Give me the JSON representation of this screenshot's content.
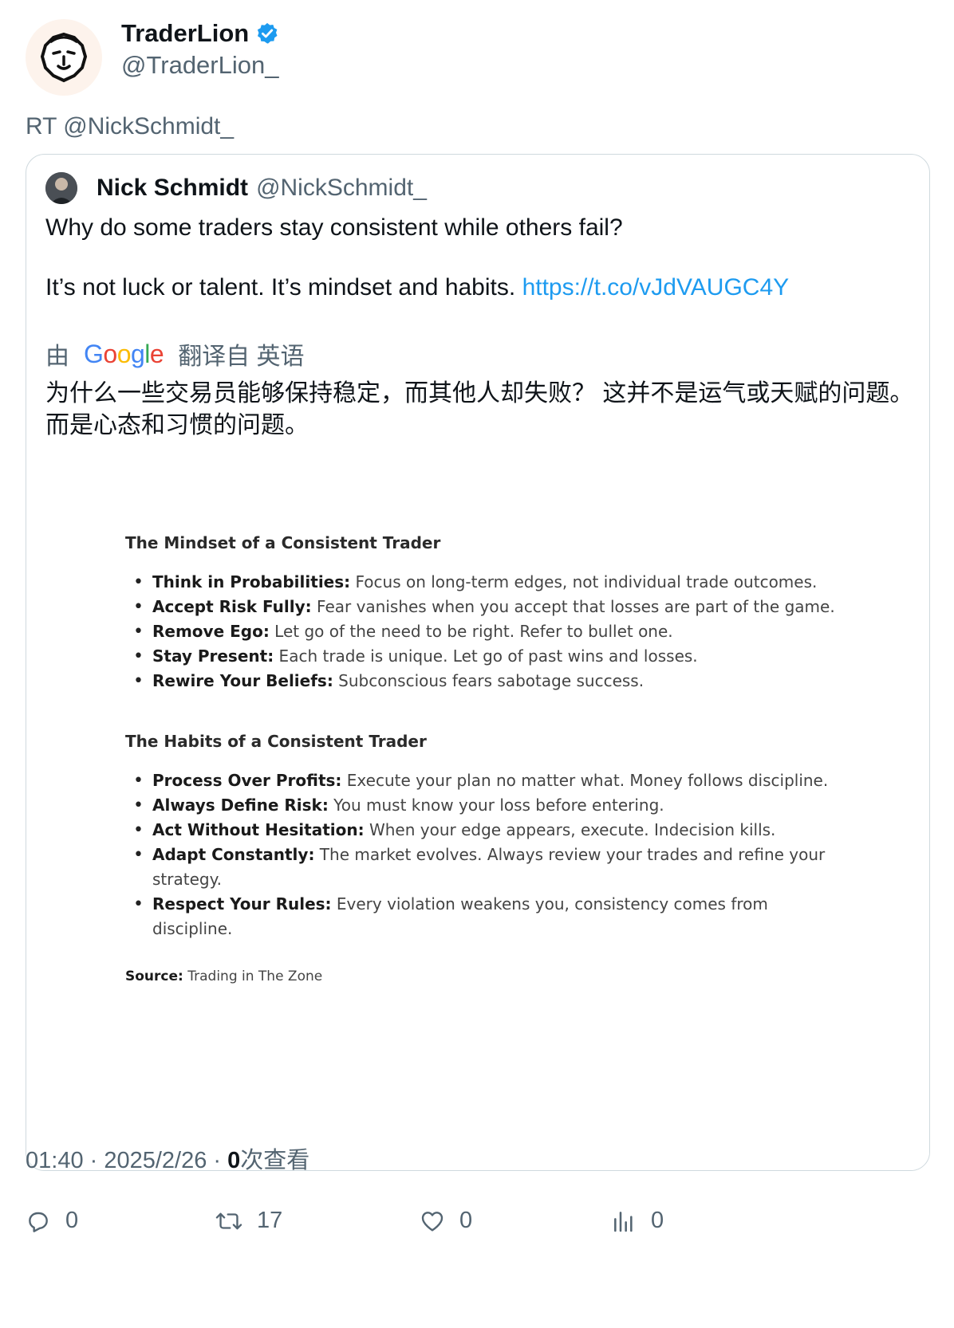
{
  "author": {
    "display_name": "TraderLion",
    "handle": "@TraderLion_",
    "verified": true
  },
  "retweet_line": "RT @NickSchmidt_",
  "quote": {
    "display_name": "Nick Schmidt",
    "handle": "@NickSchmidt_",
    "text_line1": "Why do some traders stay consistent while others fail?",
    "text_line2": "It’s not luck or talent. It’s mindset and habits.",
    "link": "https://t.co/vJdVAUGC4Y",
    "translate_prefix": "由",
    "translate_brand": "Google",
    "translate_suffix": "翻译自 英语",
    "translated_text": "为什么一些交易员能够保持稳定，而其他人却失败？ 这并不是运气或天赋的问题。而是心态和习惯的问题。"
  },
  "image_doc": {
    "mindset_title": "The Mindset of a Consistent Trader",
    "mindset_items": [
      {
        "bold": "Think in Probabilities:",
        "text": " Focus on long-term edges, not individual trade outcomes."
      },
      {
        "bold": "Accept Risk Fully:",
        "text": " Fear vanishes when you accept that losses are part of the game."
      },
      {
        "bold": "Remove Ego:",
        "text": " Let go of the need to be right. Refer to bullet one."
      },
      {
        "bold": "Stay Present:",
        "text": " Each trade is unique. Let go of past wins and losses."
      },
      {
        "bold": "Rewire Your Beliefs:",
        "text": " Subconscious fears sabotage success."
      }
    ],
    "habits_title": "The Habits of a Consistent Trader",
    "habits_items": [
      {
        "bold": "Process Over Profits:",
        "text": " Execute your plan no matter what. Money follows discipline."
      },
      {
        "bold": "Always Define Risk:",
        "text": " You must know your loss before entering."
      },
      {
        "bold": "Act Without Hesitation:",
        "text": " When your edge appears, execute. Indecision kills."
      },
      {
        "bold": "Adapt Constantly:",
        "text": " The market evolves. Always review your trades and refine your strategy."
      },
      {
        "bold": "Respect Your Rules:",
        "text": " Every violation weakens you, consistency comes from discipline."
      }
    ],
    "source_label": "Source:",
    "source_text": " Trading in The Zone"
  },
  "meta": {
    "time_date": "01:40 · 2025/2/26 · ",
    "views_count": "0",
    "views_label": "次查看"
  },
  "actions": {
    "replies": "0",
    "retweets": "17",
    "likes": "0",
    "views": "0"
  },
  "colors": {
    "link": "#1d9bf0",
    "verified": "#1d9bf0",
    "muted": "#536471"
  }
}
